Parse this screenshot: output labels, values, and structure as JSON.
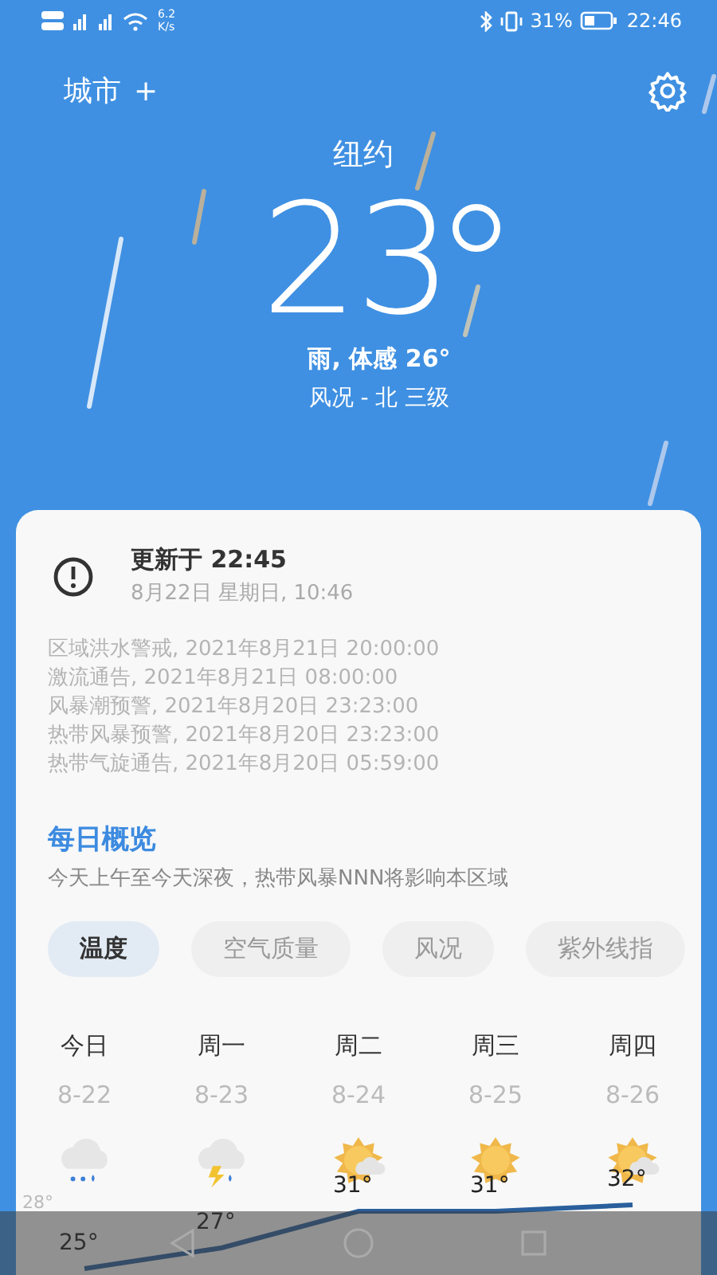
{
  "status_bar": {
    "net_speed": "6.2",
    "net_unit": "K/s",
    "battery": "31%",
    "time": "22:46"
  },
  "header": {
    "cities_label": "城市",
    "add_label": "+"
  },
  "current": {
    "city": "纽约",
    "temperature": "23",
    "condition": "雨, 体感 26°",
    "wind": "风况 - 北 三级"
  },
  "updated": {
    "title": "更新于 22:45",
    "date": "8月22日 星期日, 10:46"
  },
  "alerts": [
    "区域洪水警戒, 2021年8月21日 20:00:00",
    "激流通告, 2021年8月21日 08:00:00",
    "风暴潮预警, 2021年8月20日 23:23:00",
    "热带风暴预警, 2021年8月20日 23:23:00",
    "热带气旋通告, 2021年8月20日 05:59:00"
  ],
  "daily": {
    "title": "每日概览",
    "summary": "今天上午至今天深夜，热带风暴NNN将影响本区域"
  },
  "tabs": [
    {
      "label": "温度",
      "selected": true
    },
    {
      "label": "空气质量",
      "selected": false
    },
    {
      "label": "风况",
      "selected": false
    },
    {
      "label": "紫外线指",
      "selected": false
    }
  ],
  "forecast": [
    {
      "day": "今日",
      "date": "8-22",
      "kind": "rain",
      "temp": "25°"
    },
    {
      "day": "周一",
      "date": "8-23",
      "kind": "thunder",
      "temp": "27°"
    },
    {
      "day": "周二",
      "date": "8-24",
      "kind": "partly",
      "temp": "31°"
    },
    {
      "day": "周三",
      "date": "8-25",
      "kind": "sunny",
      "temp": "31°"
    },
    {
      "day": "周四",
      "date": "8-26",
      "kind": "partly",
      "temp": "32°"
    }
  ],
  "chart_side_label": "28°"
}
